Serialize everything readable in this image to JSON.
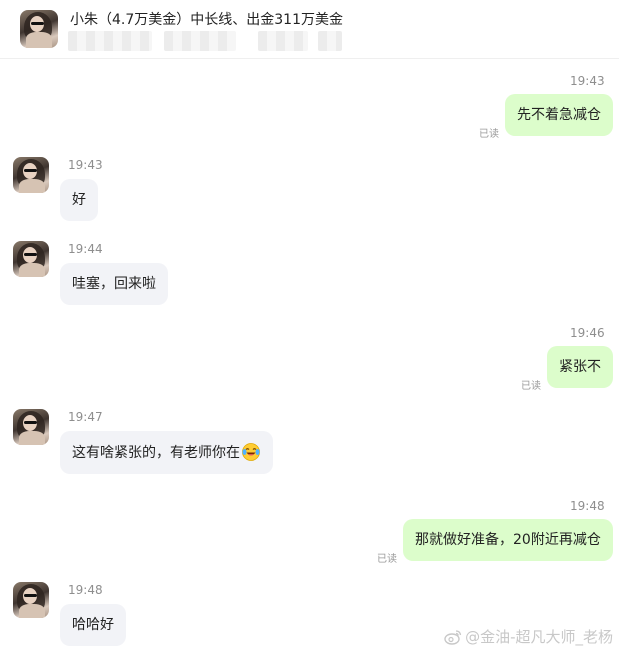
{
  "header": {
    "title": "小朱（4.7万美金）中长线、出金311万美金"
  },
  "messages": [
    {
      "side": "right",
      "time": "19:43",
      "text": "先不着急减仓",
      "status": "已读"
    },
    {
      "side": "left",
      "time": "19:43",
      "text": "好"
    },
    {
      "side": "left",
      "time": "19:44",
      "text": "哇塞，回来啦"
    },
    {
      "side": "right",
      "time": "19:46",
      "text": "紧张不",
      "status": "已读"
    },
    {
      "side": "left",
      "time": "19:47",
      "text": "这有啥紧张的，有老师你在",
      "emoji": "laughing-tears-emoji"
    },
    {
      "side": "right",
      "time": "19:48",
      "text": "那就做好准备，20附近再减仓",
      "status": "已读"
    },
    {
      "side": "left",
      "time": "19:48",
      "text": "哈哈好"
    }
  ],
  "watermark": {
    "text": "@金油-超凡大师_老杨",
    "icon": "weibo-icon"
  },
  "colors": {
    "right_bubble": "#dcfdcb",
    "left_bubble": "#f2f3f7"
  }
}
